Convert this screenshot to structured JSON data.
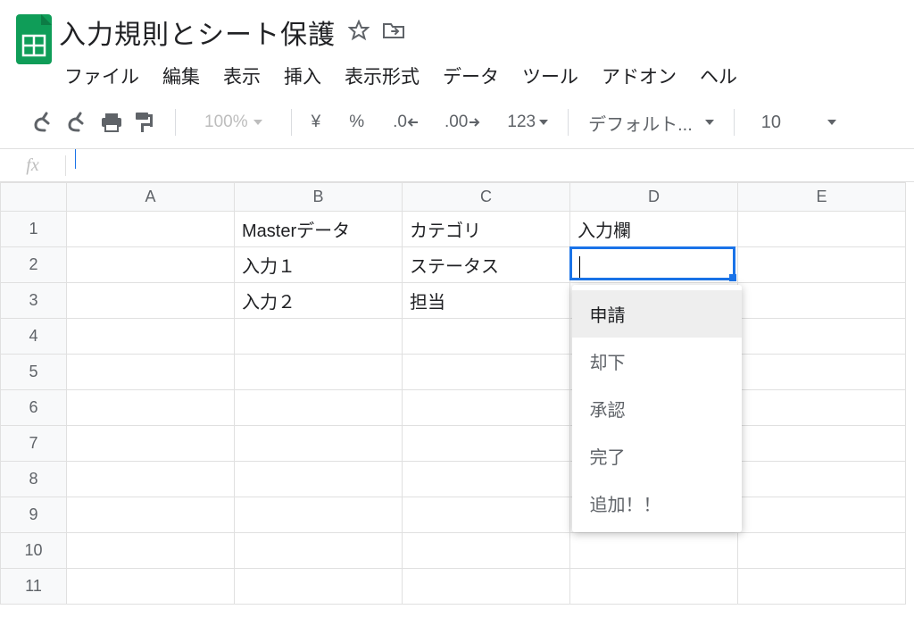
{
  "doc": {
    "title": "入力規則とシート保護"
  },
  "menu": {
    "file": "ファイル",
    "edit": "編集",
    "view": "表示",
    "insert": "挿入",
    "format": "表示形式",
    "data": "データ",
    "tools": "ツール",
    "addons": "アドオン",
    "help": "ヘル"
  },
  "toolbar": {
    "zoom": "100%",
    "currency": "¥",
    "percent": "%",
    "dec_dec": ".0",
    "dec_inc": ".00",
    "numfmt": "123",
    "font": "デフォルト...",
    "fontsize": "10"
  },
  "fx": {
    "label": "fx",
    "value": ""
  },
  "columns": [
    "A",
    "B",
    "C",
    "D",
    "E"
  ],
  "rows": [
    "1",
    "2",
    "3",
    "4",
    "5",
    "6",
    "7",
    "8",
    "9",
    "10",
    "11"
  ],
  "cells": {
    "B1": "Masterデータ",
    "C1": "カテゴリ",
    "D1": "入力欄",
    "B2": "入力１",
    "C2": "ステータス",
    "B3": "入力２",
    "C3": "担当"
  },
  "active_cell": "D2",
  "dropdown": {
    "items": [
      "申請",
      "却下",
      "承認",
      "完了",
      "追加！！"
    ],
    "hover_index": 0
  }
}
